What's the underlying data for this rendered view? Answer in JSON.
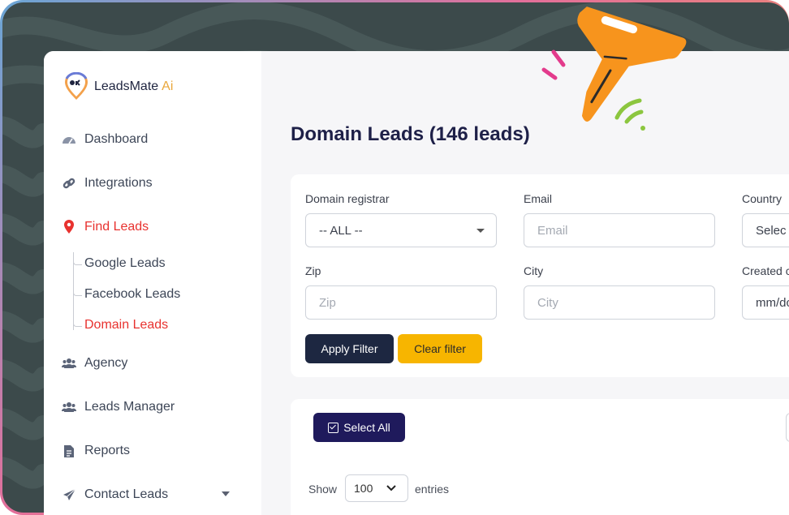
{
  "brand": {
    "name": "LeadsMate",
    "suffix": "Ai"
  },
  "sidebar": {
    "items": [
      {
        "label": "Dashboard",
        "icon": "gauge-icon"
      },
      {
        "label": "Integrations",
        "icon": "link-icon"
      },
      {
        "label": "Find Leads",
        "icon": "location-pin-icon",
        "active": true
      },
      {
        "label": "Agency",
        "icon": "users-icon"
      },
      {
        "label": "Leads Manager",
        "icon": "users-icon"
      },
      {
        "label": "Reports",
        "icon": "file-icon"
      },
      {
        "label": "Contact Leads",
        "icon": "paper-plane-icon"
      }
    ],
    "subitems": [
      {
        "label": "Google Leads"
      },
      {
        "label": "Facebook Leads"
      },
      {
        "label": "Domain Leads",
        "active": true
      }
    ]
  },
  "main": {
    "title": "Domain Leads (146 leads)",
    "filters": {
      "domain_registrar": {
        "label": "Domain registrar",
        "value": "-- ALL --"
      },
      "email": {
        "label": "Email",
        "placeholder": "Email"
      },
      "country": {
        "label": "Country",
        "value": "Selec"
      },
      "zip": {
        "label": "Zip",
        "placeholder": "Zip"
      },
      "city": {
        "label": "City",
        "placeholder": "City"
      },
      "created": {
        "label": "Created c",
        "value": "mm/dc"
      },
      "apply_label": "Apply Filter",
      "clear_label": "Clear filter"
    },
    "list": {
      "select_all_label": "Select All",
      "show_label": "Show",
      "entries_value": "100",
      "entries_label": "entries"
    }
  },
  "colors": {
    "accent_red": "#e8322f",
    "navy": "#1e2048",
    "apply_bg": "#1d2741",
    "clear_bg": "#f7b500",
    "select_all_bg": "#1f1a5c",
    "funnel": "#f7941d"
  }
}
